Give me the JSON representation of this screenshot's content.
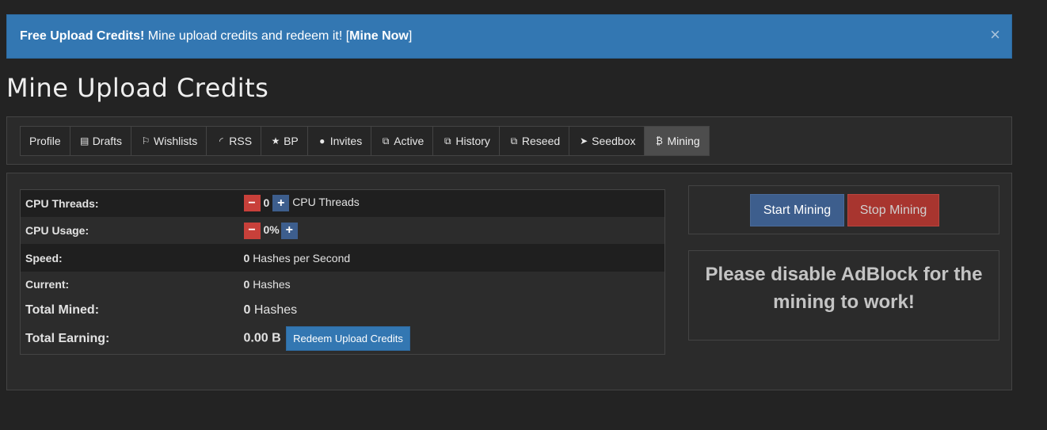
{
  "alert": {
    "lead": "Free Upload Credits!",
    "text": " Mine upload credits and redeem it! [",
    "link": "Mine Now",
    "tail": "]",
    "close": "×"
  },
  "page_title": "Mine Upload Credits",
  "tabs": [
    {
      "label": "Profile",
      "icon": "",
      "icon_name": ""
    },
    {
      "label": "Drafts",
      "icon": "▤",
      "icon_name": "document-icon"
    },
    {
      "label": "Wishlists",
      "icon": "⚐",
      "icon_name": "bookmark-icon"
    },
    {
      "label": "RSS",
      "icon": "◜",
      "icon_name": "rss-icon"
    },
    {
      "label": "BP",
      "icon": "★",
      "icon_name": "star-icon"
    },
    {
      "label": "Invites",
      "icon": "●",
      "icon_name": "user-icon"
    },
    {
      "label": "Active",
      "icon": "⧉",
      "icon_name": "copy-icon"
    },
    {
      "label": "History",
      "icon": "⧉",
      "icon_name": "copy-icon"
    },
    {
      "label": "Reseed",
      "icon": "⧉",
      "icon_name": "copy-icon"
    },
    {
      "label": "Seedbox",
      "icon": "➤",
      "icon_name": "paper-plane-icon"
    },
    {
      "label": "Mining",
      "icon": "₿",
      "icon_name": "bitcoin-icon",
      "active": true
    }
  ],
  "stats": {
    "cpu_threads": {
      "label": "CPU Threads:",
      "value": "0",
      "suffix": "CPU Threads",
      "minus": "−",
      "plus": "+"
    },
    "cpu_usage": {
      "label": "CPU Usage:",
      "value": "0%",
      "minus": "−",
      "plus": "+"
    },
    "speed": {
      "label": "Speed:",
      "value": "0",
      "suffix": "Hashes per Second"
    },
    "current": {
      "label": "Current:",
      "value": "0",
      "suffix": "Hashes"
    },
    "total_mined": {
      "label": "Total Mined:",
      "value": "0",
      "suffix": "Hashes"
    },
    "total_earning": {
      "label": "Total Earning:",
      "value": "0.00 B",
      "button": "Redeem Upload Credits"
    }
  },
  "controls": {
    "start": "Start Mining",
    "stop": "Stop Mining"
  },
  "message": "Please disable AdBlock for the mining to work!",
  "colors": {
    "background": "#232323",
    "alert": "#3377b2",
    "start_button": "#3d5e8d",
    "stop_button": "#a8352f",
    "minus_button": "#c8403a"
  }
}
